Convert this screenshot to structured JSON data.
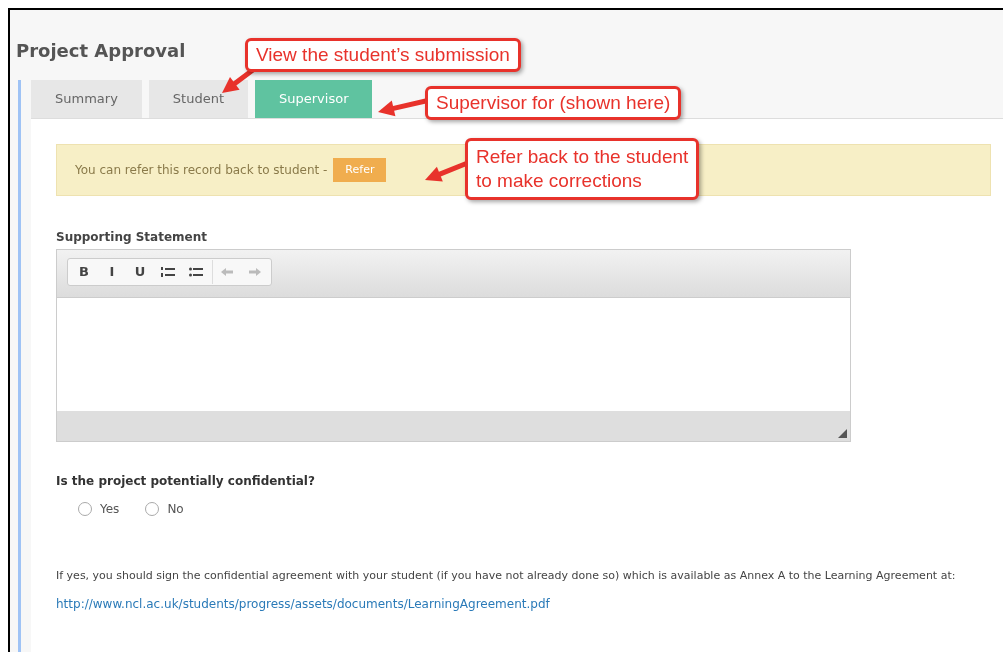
{
  "title": "Project Approval",
  "tabs": [
    {
      "label": "Summary",
      "selected": false
    },
    {
      "label": "Student",
      "selected": false
    },
    {
      "label": "Supervisor",
      "selected": true
    }
  ],
  "alert": {
    "text": "You can refer this record back to student -",
    "button": "Refer"
  },
  "statement": {
    "label": "Supporting Statement",
    "toolbar": [
      {
        "kind": "text",
        "label": "B"
      },
      {
        "kind": "text",
        "label": "I"
      },
      {
        "kind": "text",
        "label": "U"
      },
      {
        "kind": "numbered-list"
      },
      {
        "kind": "bullet-list"
      },
      {
        "kind": "undo",
        "disabled": true
      },
      {
        "kind": "redo",
        "disabled": true
      }
    ]
  },
  "question": {
    "label": "Is the project potentially confidential?",
    "options": [
      {
        "label": "Yes",
        "selected": false
      },
      {
        "label": "No",
        "selected": false
      }
    ]
  },
  "note": "If yes, you should sign the confidential agreement with your student (if you have not already done so) which is available as Annex A to the Learning Agreement at:",
  "link": "http://www.ncl.ac.uk/students/progress/assets/documents/LearningAgreement.pdf",
  "annotations": [
    {
      "text": "View the student’s submission"
    },
    {
      "text": "Supervisor for (shown here)"
    },
    {
      "text": "Refer back to the student\nto make corrections"
    }
  ]
}
